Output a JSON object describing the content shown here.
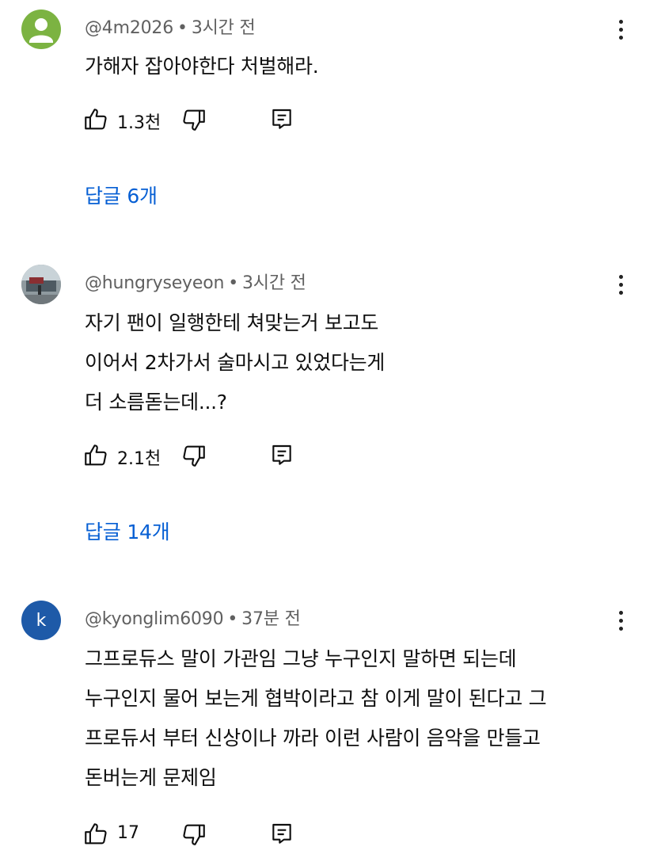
{
  "comments": [
    {
      "handle": "@4m2026",
      "time": "3시간 전",
      "lines": [
        "가해자 잡아야한다 처벌해라."
      ],
      "likes": "1.3천",
      "replies": "답글 6개",
      "avatar": {
        "type": "default-person-icon",
        "color": "#7cb342"
      }
    },
    {
      "handle": "@hungryseyeon",
      "time": "3시간 전",
      "lines": [
        "자기 팬이 일행한테 쳐맞는거 보고도",
        "이어서 2차가서 술마시고 있었다는게",
        "더 소름돋는데...?"
      ],
      "likes": "2.1천",
      "replies": "답글 14개",
      "avatar": {
        "type": "photo"
      }
    },
    {
      "handle": "@kyonglim6090",
      "time": "37분 전",
      "lines": [
        "그프로듀스 말이 가관임 그냥 누구인지 말하면 되는데",
        "누구인지 물어 보는게 협박이라고 참 이게 말이 된다고 그",
        "프로듀서 부터 신상이나 까라 이런 사람이 음악을 만들고",
        "돈버는게 문제임"
      ],
      "likes": "17",
      "avatar": {
        "type": "letter",
        "letter": "k",
        "color": "#1e5aa8"
      }
    }
  ],
  "separator": "•",
  "colors": {
    "link": "#065fd4",
    "meta": "#606060",
    "text": "#0f0f0f"
  }
}
